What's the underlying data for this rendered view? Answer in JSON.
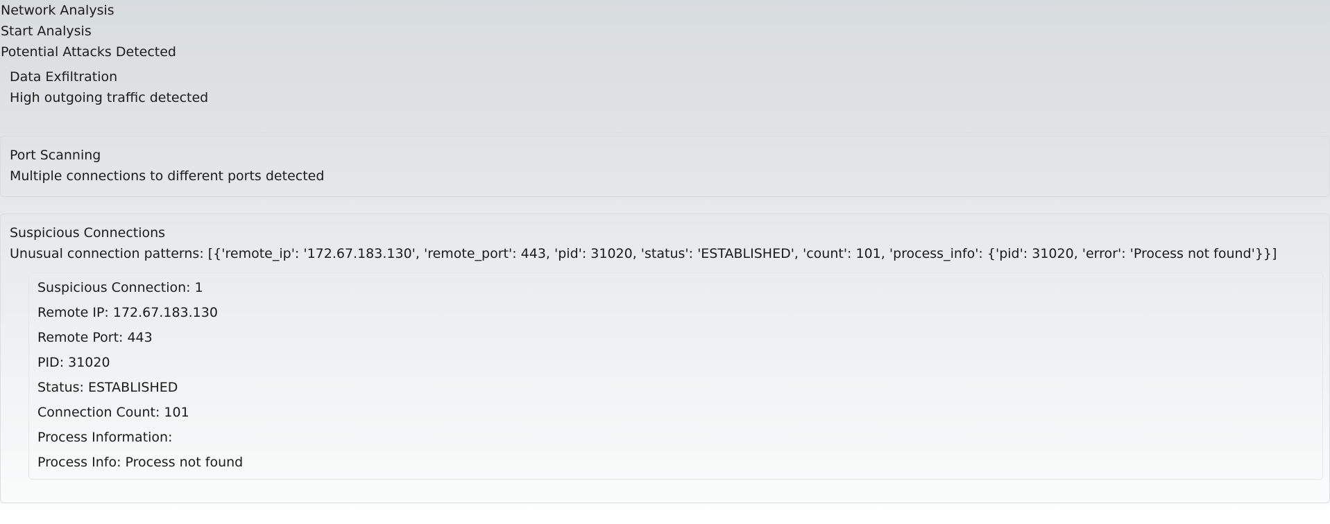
{
  "app": {
    "title": "Network Analysis",
    "start_label": "Start Analysis",
    "attacks_heading": "Potential Attacks Detected"
  },
  "attacks": [
    {
      "name": "Data Exfiltration",
      "description": "High outgoing traffic detected"
    },
    {
      "name": "Port Scanning",
      "description": "Multiple connections to different ports detected"
    },
    {
      "name": "Suspicious Connections",
      "description": "Unusual connection patterns: [{'remote_ip': '172.67.183.130', 'remote_port': 443, 'pid': 31020, 'status': 'ESTABLISHED', 'count': 101, 'process_info': {'pid': 31020, 'error': 'Process not found'}}]"
    }
  ],
  "connection": {
    "title": "Suspicious Connection: 1",
    "remote_ip": "Remote IP: 172.67.183.130",
    "remote_port": "Remote Port: 443",
    "pid": "PID: 31020",
    "status": "Status: ESTABLISHED",
    "count": "Connection Count: 101",
    "process_header": "Process Information:",
    "process_info": "Process Info: Process not found"
  }
}
